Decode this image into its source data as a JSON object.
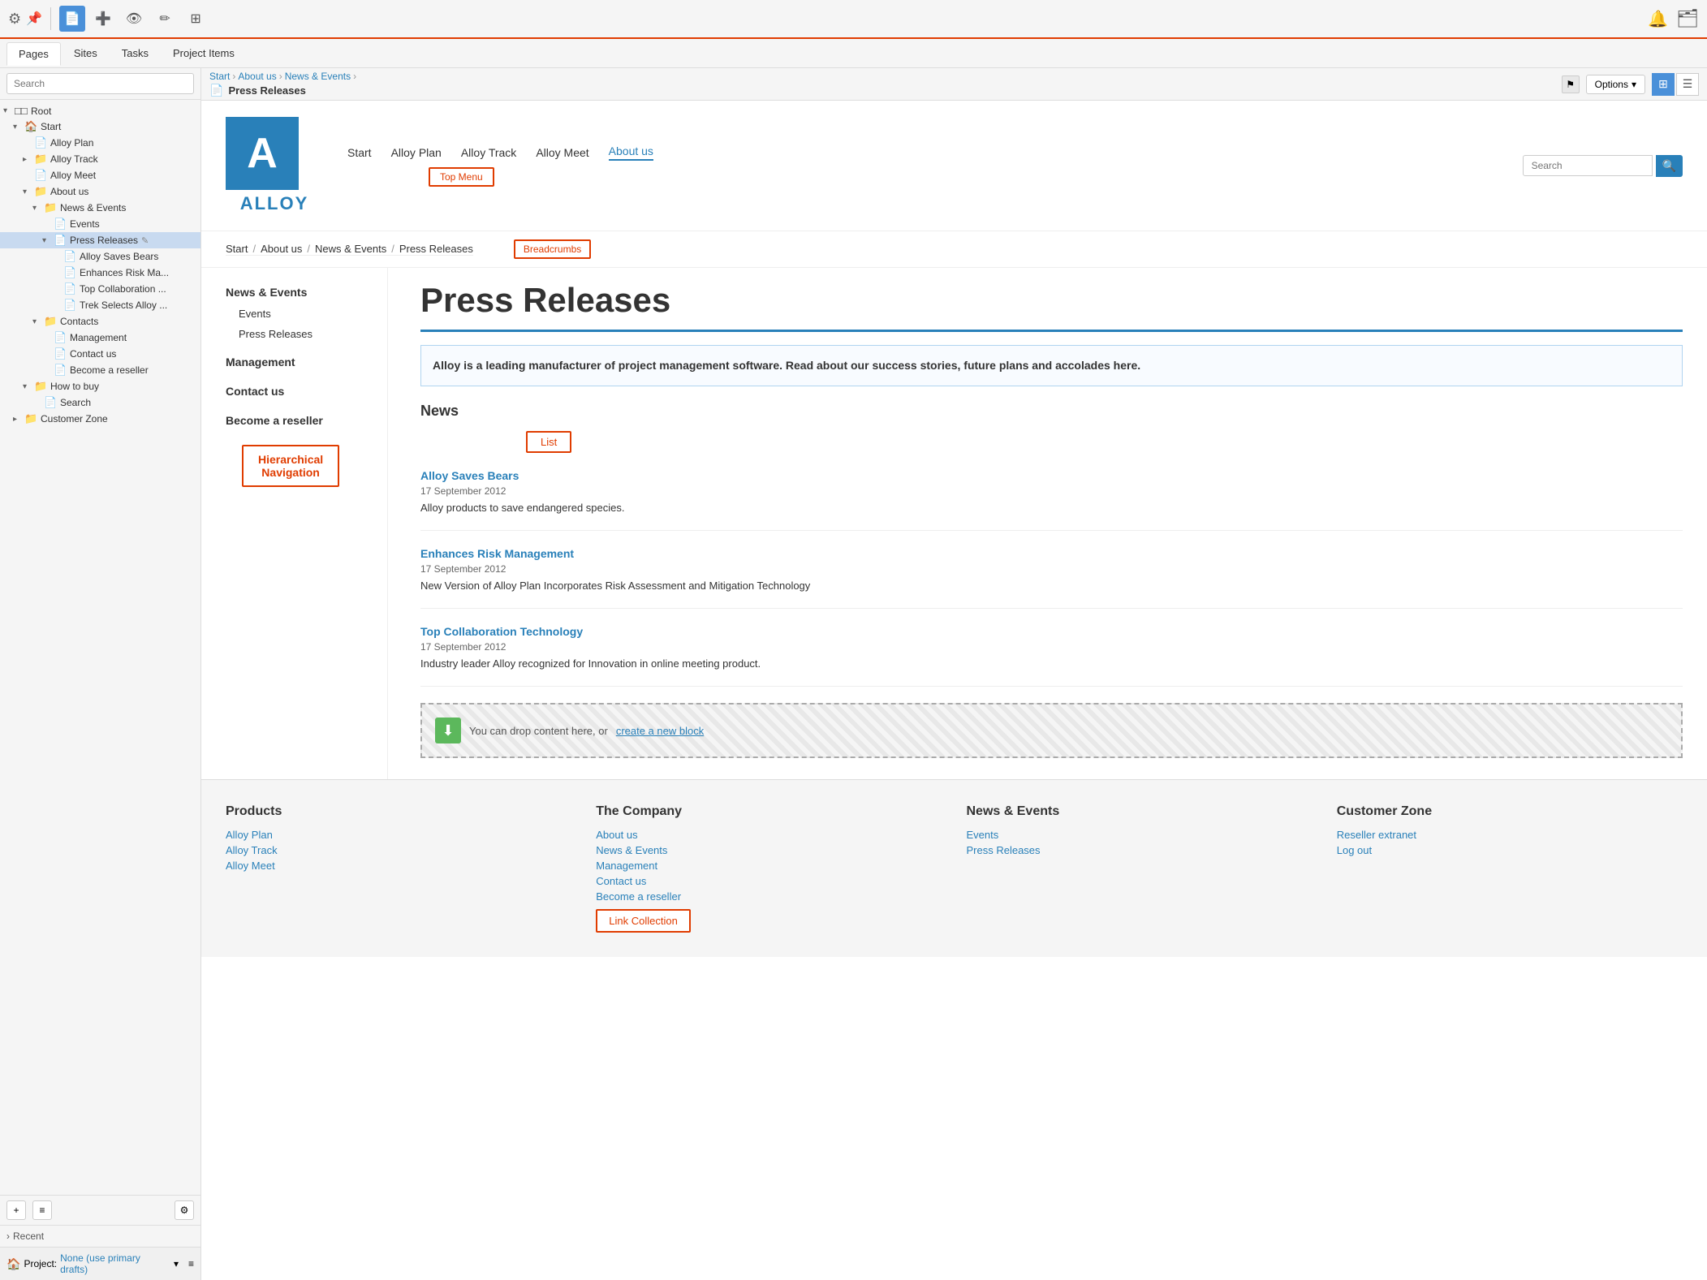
{
  "toolbar": {
    "gear_label": "⚙",
    "pin_label": "📌",
    "pages_tab": "Pages",
    "sites_tab": "Sites",
    "tasks_tab": "Tasks",
    "project_items_tab": "Project Items",
    "bell_label": "🔔",
    "folder_label": "🗂"
  },
  "sidebar": {
    "search_placeholder": "Search",
    "tree": [
      {
        "label": "Root",
        "level": 0,
        "expanded": true,
        "type": "root",
        "icon": "root"
      },
      {
        "label": "Start",
        "level": 1,
        "expanded": true,
        "type": "folder",
        "icon": "home"
      },
      {
        "label": "Alloy Plan",
        "level": 2,
        "expanded": false,
        "type": "page",
        "icon": "page"
      },
      {
        "label": "Alloy Track",
        "level": 2,
        "expanded": true,
        "type": "folder-page",
        "icon": "folder-page"
      },
      {
        "label": "Alloy Meet",
        "level": 2,
        "expanded": false,
        "type": "page",
        "icon": "page"
      },
      {
        "label": "About us",
        "level": 2,
        "expanded": true,
        "type": "folder-page",
        "icon": "folder-page"
      },
      {
        "label": "News & Events",
        "level": 3,
        "expanded": true,
        "type": "folder-page",
        "icon": "folder-page"
      },
      {
        "label": "Events",
        "level": 4,
        "expanded": false,
        "type": "page",
        "icon": "page"
      },
      {
        "label": "Press Releases",
        "level": 4,
        "expanded": true,
        "type": "page",
        "icon": "page",
        "selected": true
      },
      {
        "label": "Alloy Saves Bears",
        "level": 5,
        "expanded": false,
        "type": "page",
        "icon": "page"
      },
      {
        "label": "Enhances Risk Ma...",
        "level": 5,
        "expanded": false,
        "type": "page",
        "icon": "page"
      },
      {
        "label": "Top Collaboration ...",
        "level": 5,
        "expanded": false,
        "type": "page",
        "icon": "page"
      },
      {
        "label": "Trek Selects Alloy ...",
        "level": 5,
        "expanded": false,
        "type": "page",
        "icon": "page"
      },
      {
        "label": "Contacts",
        "level": 3,
        "expanded": true,
        "type": "folder",
        "icon": "folder"
      },
      {
        "label": "Management",
        "level": 4,
        "expanded": false,
        "type": "page",
        "icon": "page"
      },
      {
        "label": "Contact us",
        "level": 4,
        "expanded": false,
        "type": "page",
        "icon": "page"
      },
      {
        "label": "Become a reseller",
        "level": 4,
        "expanded": false,
        "type": "page",
        "icon": "page"
      },
      {
        "label": "How to buy",
        "level": 2,
        "expanded": true,
        "type": "folder",
        "icon": "folder"
      },
      {
        "label": "Search",
        "level": 3,
        "expanded": false,
        "type": "page",
        "icon": "page"
      },
      {
        "label": "Customer Zone",
        "level": 1,
        "expanded": false,
        "type": "folder",
        "icon": "folder"
      }
    ],
    "recent_label": "Recent",
    "project_label": "Project:",
    "project_value": "None (use primary drafts)",
    "add_btn": "+",
    "list_btn": "≡",
    "gear_btn": "⚙"
  },
  "content_toolbar": {
    "breadcrumb": [
      "Start",
      "About us",
      "News & Events"
    ],
    "page_title": "Press Releases",
    "flag_icon": "⚑",
    "options_label": "Options",
    "chevron": "▾",
    "view_grid_icon": "⊞",
    "view_list_icon": "☰"
  },
  "alloy_site": {
    "logo_letter": "A",
    "logo_text": "ALLOY",
    "nav_items": [
      "Start",
      "Alloy Plan",
      "Alloy Track",
      "Alloy Meet",
      "About us"
    ],
    "nav_active": "About us",
    "search_placeholder": "Search",
    "top_menu_label": "Top Menu",
    "breadcrumb_items": [
      "Start",
      "About us",
      "News & Events",
      "Press Releases"
    ],
    "breadcrumbs_label": "Breadcrumbs",
    "left_nav": {
      "title1": "News & Events",
      "item1_1": "Events",
      "item1_2": "Press Releases",
      "title2": "Management",
      "title3": "Contact us",
      "title4": "Become a reseller"
    },
    "hier_nav_label": "Hierarchical\nNavigation",
    "main_title": "Press Releases",
    "description": "Alloy is a leading manufacturer of project management software. Read about our success stories, future plans and accolades here.",
    "news_title": "News",
    "list_label": "List",
    "news_items": [
      {
        "title": "Alloy Saves Bears",
        "date": "17 September 2012",
        "description": "Alloy products to save endangered species."
      },
      {
        "title": "Enhances Risk Management",
        "date": "17 September 2012",
        "description": "New Version of Alloy Plan Incorporates Risk Assessment and Mitigation Technology"
      },
      {
        "title": "Top Collaboration Technology",
        "date": "17 September 2012",
        "description": "Industry leader Alloy recognized for Innovation in online meeting product."
      }
    ],
    "drop_text": "You can drop content here, or ",
    "drop_link": "create a new block",
    "footer": {
      "col1_title": "Products",
      "col1_links": [
        "Alloy Plan",
        "Alloy Track",
        "Alloy Meet"
      ],
      "col2_title": "The Company",
      "col2_links": [
        "About us",
        "News & Events",
        "Management",
        "Contact us",
        "Become a reseller"
      ],
      "col3_title": "News & Events",
      "col3_links": [
        "Events",
        "Press Releases"
      ],
      "col4_title": "Customer Zone",
      "col4_links": [
        "Reseller extranet",
        "Log out"
      ],
      "link_collection_label": "Link Collection"
    }
  }
}
